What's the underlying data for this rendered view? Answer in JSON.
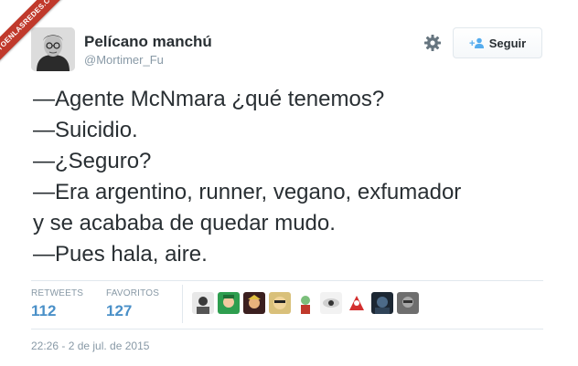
{
  "watermark": {
    "text": "VISTOENLASREDES.COM"
  },
  "user": {
    "display_name": "Pelícano manchú",
    "handle": "@Mortimer_Fu",
    "avatar_icon": "user-avatar-photo"
  },
  "actions": {
    "gear_icon": "gear-icon",
    "follow_label": "Seguir",
    "follow_icon": "add-user-icon"
  },
  "tweet": {
    "lines": [
      "—Agente McNmara ¿qué tenemos?",
      "—Suicidio.",
      "—¿Seguro?",
      "—Era argentino, runner, vegano, exfumador",
      "y se acababa de quedar mudo.",
      "—Pues hala, aire."
    ]
  },
  "stats": {
    "retweets_label": "RETWEETS",
    "retweets_value": "112",
    "favorites_label": "FAVORITOS",
    "favorites_value": "127"
  },
  "timestamp": "22:26 - 2 de jul. de 2015",
  "colors": {
    "link_blue": "#4a90c8",
    "text_dark": "#292f33",
    "text_muted": "#8899a6",
    "ribbon_red": "#c0392b"
  }
}
